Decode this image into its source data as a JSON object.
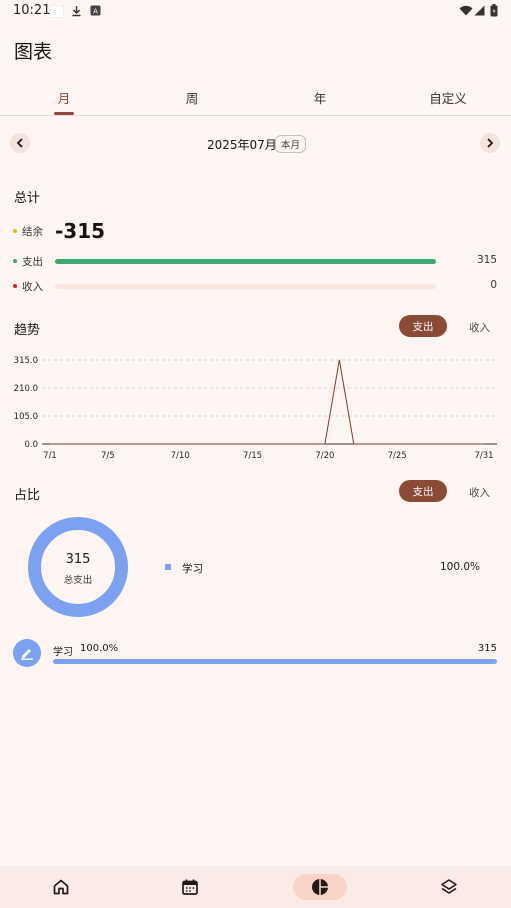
{
  "status_bar": {
    "time": "10:21"
  },
  "page": {
    "title": "图表"
  },
  "tabs": [
    {
      "label": "月",
      "active": true
    },
    {
      "label": "周",
      "active": false
    },
    {
      "label": "年",
      "active": false
    },
    {
      "label": "自定义",
      "active": false
    }
  ],
  "period": {
    "label": "2025年07月",
    "chip": "本月"
  },
  "summary": {
    "title": "总计",
    "balance_label": "结余",
    "balance_value": "-315",
    "expense_label": "支出",
    "expense_value": "315",
    "expense_fraction": 1.0,
    "income_label": "收入",
    "income_value": "0",
    "income_fraction": 0,
    "colors": {
      "balance": "#f2b705",
      "expense": "#3ea66e",
      "income": "#c62828"
    }
  },
  "trend": {
    "title": "趋势",
    "toggle_on": "支出",
    "toggle_off": "收入"
  },
  "chart_data": {
    "type": "line",
    "title": "",
    "xlabel": "",
    "ylabel": "",
    "x": [
      1,
      2,
      3,
      4,
      5,
      6,
      7,
      8,
      9,
      10,
      11,
      12,
      13,
      14,
      15,
      16,
      17,
      18,
      19,
      20,
      21,
      22,
      23,
      24,
      25,
      26,
      27,
      28,
      29,
      30,
      31
    ],
    "values": [
      0,
      0,
      0,
      0,
      0,
      0,
      0,
      0,
      0,
      0,
      0,
      0,
      0,
      0,
      0,
      0,
      0,
      0,
      0,
      0,
      315,
      0,
      0,
      0,
      0,
      0,
      0,
      0,
      0,
      0,
      0
    ],
    "y_ticks": [
      "0.0",
      "105.0",
      "210.0",
      "315.0"
    ],
    "x_ticks": [
      "7/1",
      "7/5",
      "7/10",
      "7/15",
      "7/20",
      "7/25",
      "7/31"
    ],
    "x_tick_days": [
      1,
      5,
      10,
      15,
      20,
      25,
      31
    ],
    "ylim": [
      0,
      315
    ],
    "grid": true,
    "line_color": "#7a3e30"
  },
  "ratio": {
    "title": "占比",
    "toggle_on": "支出",
    "toggle_off": "收入",
    "donut_total": "315",
    "donut_sub": "总支出",
    "donut_color": "#7ba1f0",
    "legend": [
      {
        "name": "学习",
        "percent": "100.0%"
      }
    ]
  },
  "categories": [
    {
      "name": "学习",
      "percent": "100.0%",
      "amount": "315",
      "fraction": 1.0,
      "icon": "pencil-icon"
    }
  ],
  "bottom_nav": [
    {
      "icon": "home-icon",
      "active": false
    },
    {
      "icon": "calendar-icon",
      "active": false
    },
    {
      "icon": "pie-chart-icon",
      "active": true
    },
    {
      "icon": "layers-icon",
      "active": false
    }
  ]
}
